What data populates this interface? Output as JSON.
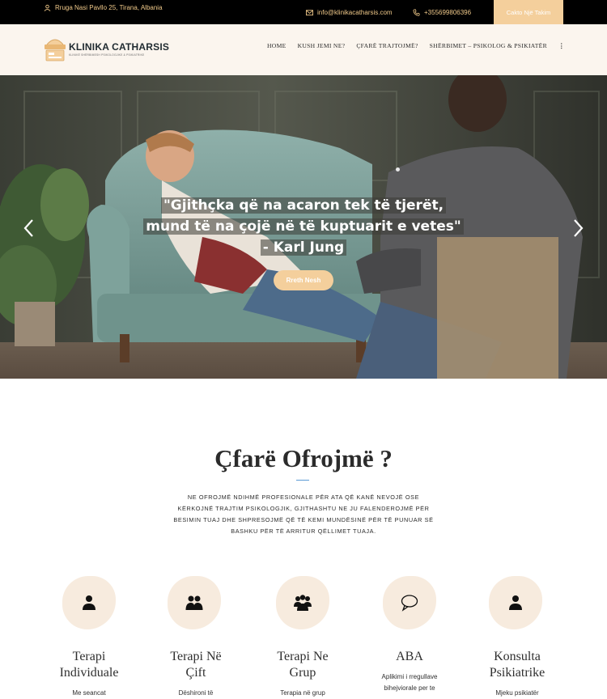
{
  "topbar": {
    "address": "Rruga Nasi Pavllo 25, Tirana, Albania",
    "email": "info@klinikacatharsis.com",
    "phone": "+355699806396",
    "cta_label": "Cakto Një Takim"
  },
  "header": {
    "logo_name": "KLINIKA CATHARSIS",
    "logo_badge": "CATHARSIS",
    "logo_tagline": "KLINIKË SHËRBIMESH PSIKOLOGJIKE & PSIKIATRIKE",
    "nav": [
      "HOME",
      "KUSH JEMI NE?",
      "ÇFARË TRAJTOJMË?",
      "SHËRBIMET – PSIKOLOG & PSIKIATËR",
      "⋮"
    ]
  },
  "hero": {
    "quote_line1": "\"Gjithçka që na acaron tek të tjerët,",
    "quote_line2": "mund të na çojë në të kuptuarit e vetes\"",
    "quote_line3": "- Karl Jung",
    "button_label": "Rreth Nesh"
  },
  "services": {
    "title": "Çfarë Ofrojmë ?",
    "description": "NE OFROJMË NDIHMË PROFESIONALE PËR ATA QË KANË NEVOJË OSE KËRKOJNË TRAJTIM PSIKOLOGJIK, GJITHASHTU NE JU FALENDEROJMË PËR BESIMIN TUAJ DHE SHPRESOJMË QË TË KEMI MUNDËSINË PËR TË PUNUAR SË BASHKU PËR TË ARRITUR QËLLIMET TUAJA.",
    "cards": [
      {
        "icon": "person-icon",
        "title_l1": "Terapi",
        "title_l2": "Individuale",
        "text": "Me seancat"
      },
      {
        "icon": "couple-icon",
        "title_l1": "Terapi Në",
        "title_l2": "Çift",
        "text": "Dëshironi të"
      },
      {
        "icon": "group-icon",
        "title_l1": "Terapi Ne",
        "title_l2": "Grup",
        "text": "Terapia në grup"
      },
      {
        "icon": "speech-bubble-icon",
        "title_l1": "ABA",
        "title_l2": "",
        "text_l1": "Aplikimi i rregullave",
        "text_l2": "bihejviorale per te"
      },
      {
        "icon": "person-icon",
        "title_l1": "Konsulta",
        "title_l2": "Psikiatrike",
        "text": "Mjeku psikiatër"
      }
    ]
  },
  "colors": {
    "accent": "#f4cf9c",
    "topbar_bg": "#000000",
    "header_bg": "#fbf5ee",
    "icon_blob": "#f7ebde"
  }
}
